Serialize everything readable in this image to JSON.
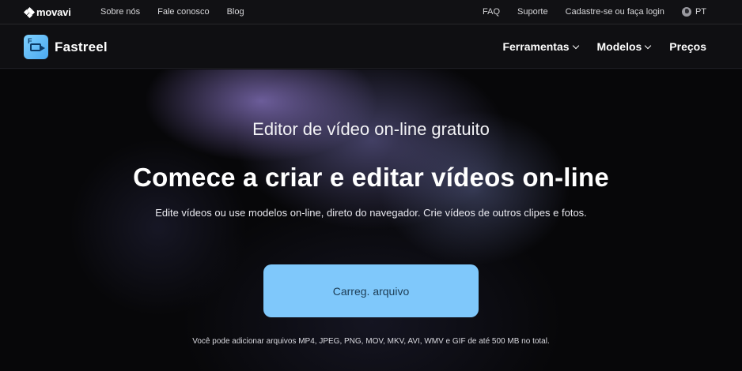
{
  "topbar": {
    "logo_text": "movavi",
    "left_links": [
      "Sobre nós",
      "Fale conosco",
      "Blog"
    ],
    "right_links": [
      "FAQ",
      "Suporte",
      "Cadastre-se ou faça login"
    ],
    "language": "PT"
  },
  "header": {
    "brand": "Fastreel",
    "nav": [
      {
        "label": "Ferramentas",
        "has_dropdown": true
      },
      {
        "label": "Modelos",
        "has_dropdown": true
      },
      {
        "label": "Preços",
        "has_dropdown": false
      }
    ]
  },
  "hero": {
    "eyebrow": "Editor de vídeo on-line gratuito",
    "headline": "Comece a criar e editar vídeos on-line",
    "subline": "Edite vídeos ou use modelos on-line, direto do navegador. Crie vídeos de outros clipes e fotos.",
    "upload_label": "Carreg. arquivo",
    "note": "Você pode adicionar arquivos MP4, JPEG, PNG, MOV, MKV, AVI, WMV e GIF de até 500 MB no total."
  },
  "colors": {
    "accent": "#7fc8fb",
    "background": "#0b0b0d",
    "upload_text": "#1d3d55"
  },
  "icons": [
    "movavi-logo-icon",
    "fastreel-logo-icon",
    "globe-icon",
    "chevron-down-icon"
  ]
}
